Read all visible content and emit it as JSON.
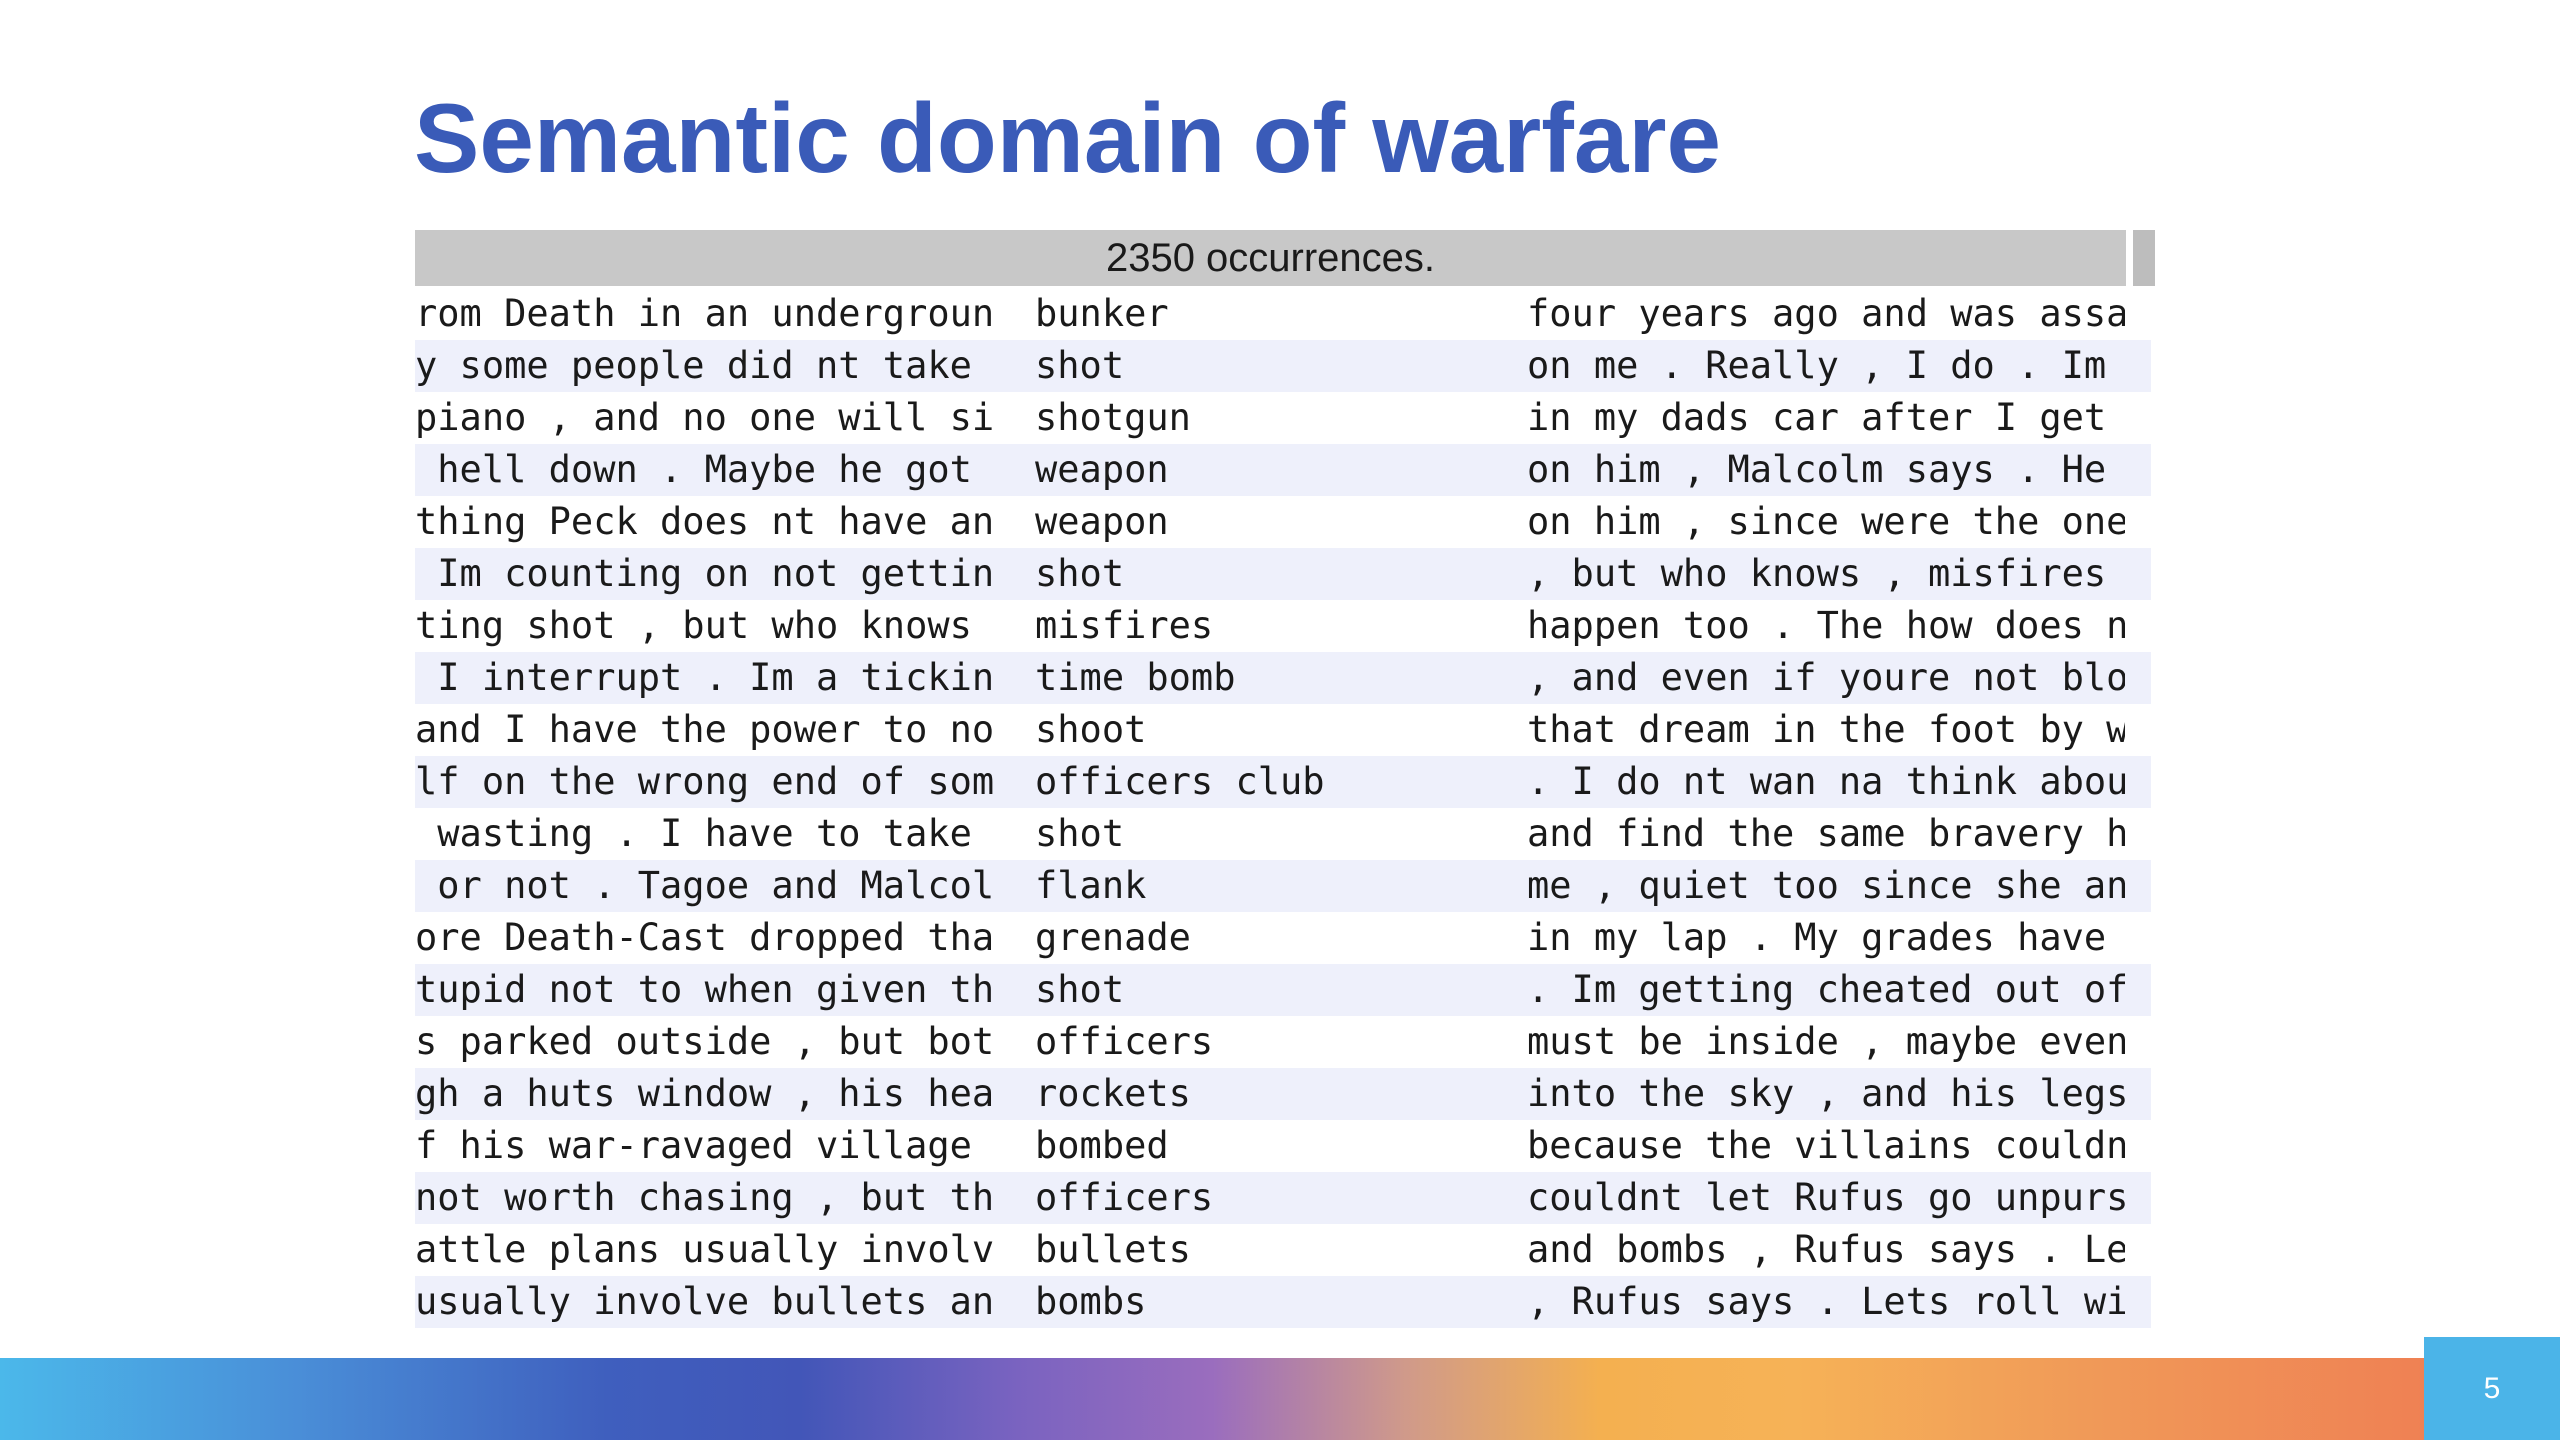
{
  "slide": {
    "title": "Semantic domain of warfare",
    "page_number": "5"
  },
  "concordance": {
    "header": "2350 occurrences.",
    "rows": [
      {
        "left": "rom Death in an underground",
        "keyword": "bunker",
        "right": "four years ago and was assas"
      },
      {
        "left": "y some people did nt take a",
        "keyword": "shot",
        "right": "on me . Really , I do . Im s"
      },
      {
        "left": "piano , and no one will sit",
        "keyword": "shotgun",
        "right": "in my dads car after I get m"
      },
      {
        "left": " hell down . Maybe he got a",
        "keyword": "weapon",
        "right": "on him , Malcolm says . He s"
      },
      {
        "left": "thing Peck does nt have any",
        "keyword": "weapon",
        "right": "on him , since were the ones"
      },
      {
        "left": " Im counting on not getting",
        "keyword": "shot",
        "right": ", but who knows , misfires h"
      },
      {
        "left": "ting shot , but who knows ,",
        "keyword": "misfires",
        "right": "happen too . The how does nt"
      },
      {
        "left": " I interrupt . Im a ticking",
        "keyword": "time bomb",
        "right": ", and even if youre not blow"
      },
      {
        "left": "and I have the power to not",
        "keyword": "shoot",
        "right": "that dream in the foot by wa"
      },
      {
        "left": "lf on the wrong end of some",
        "keyword": "officers club",
        "right": ". I do nt wan na think about"
      },
      {
        "left": " wasting . I have to take a",
        "keyword": "shot",
        "right": "and find the same bravery hu"
      },
      {
        "left": " or not . Tagoe and Malcolm",
        "keyword": "flank",
        "right": "me , quiet too since she and"
      },
      {
        "left": "ore Death-Cast dropped that",
        "keyword": "grenade",
        "right": "in my lap . My grades have a"
      },
      {
        "left": "tupid not to when given the",
        "keyword": "shot",
        "right": ". Im getting cheated out of "
      },
      {
        "left": "s parked outside , but both",
        "keyword": "officers",
        "right": "must be inside , maybe even "
      },
      {
        "left": "gh a huts window , his head",
        "keyword": "rockets",
        "right": "into the sky , and his legs "
      },
      {
        "left": "f his war-ravaged village ,",
        "keyword": "bombed",
        "right": "because the villains couldnt"
      },
      {
        "left": "not worth chasing , but the",
        "keyword": "officers",
        "right": "couldnt let Rufus go unpursu"
      },
      {
        "left": "attle plans usually involve",
        "keyword": "bullets",
        "right": "and bombs , Rufus says . Let"
      },
      {
        "left": "usually involve bullets and",
        "keyword": "bombs",
        "right": ", Rufus says . Lets roll wit"
      }
    ]
  }
}
